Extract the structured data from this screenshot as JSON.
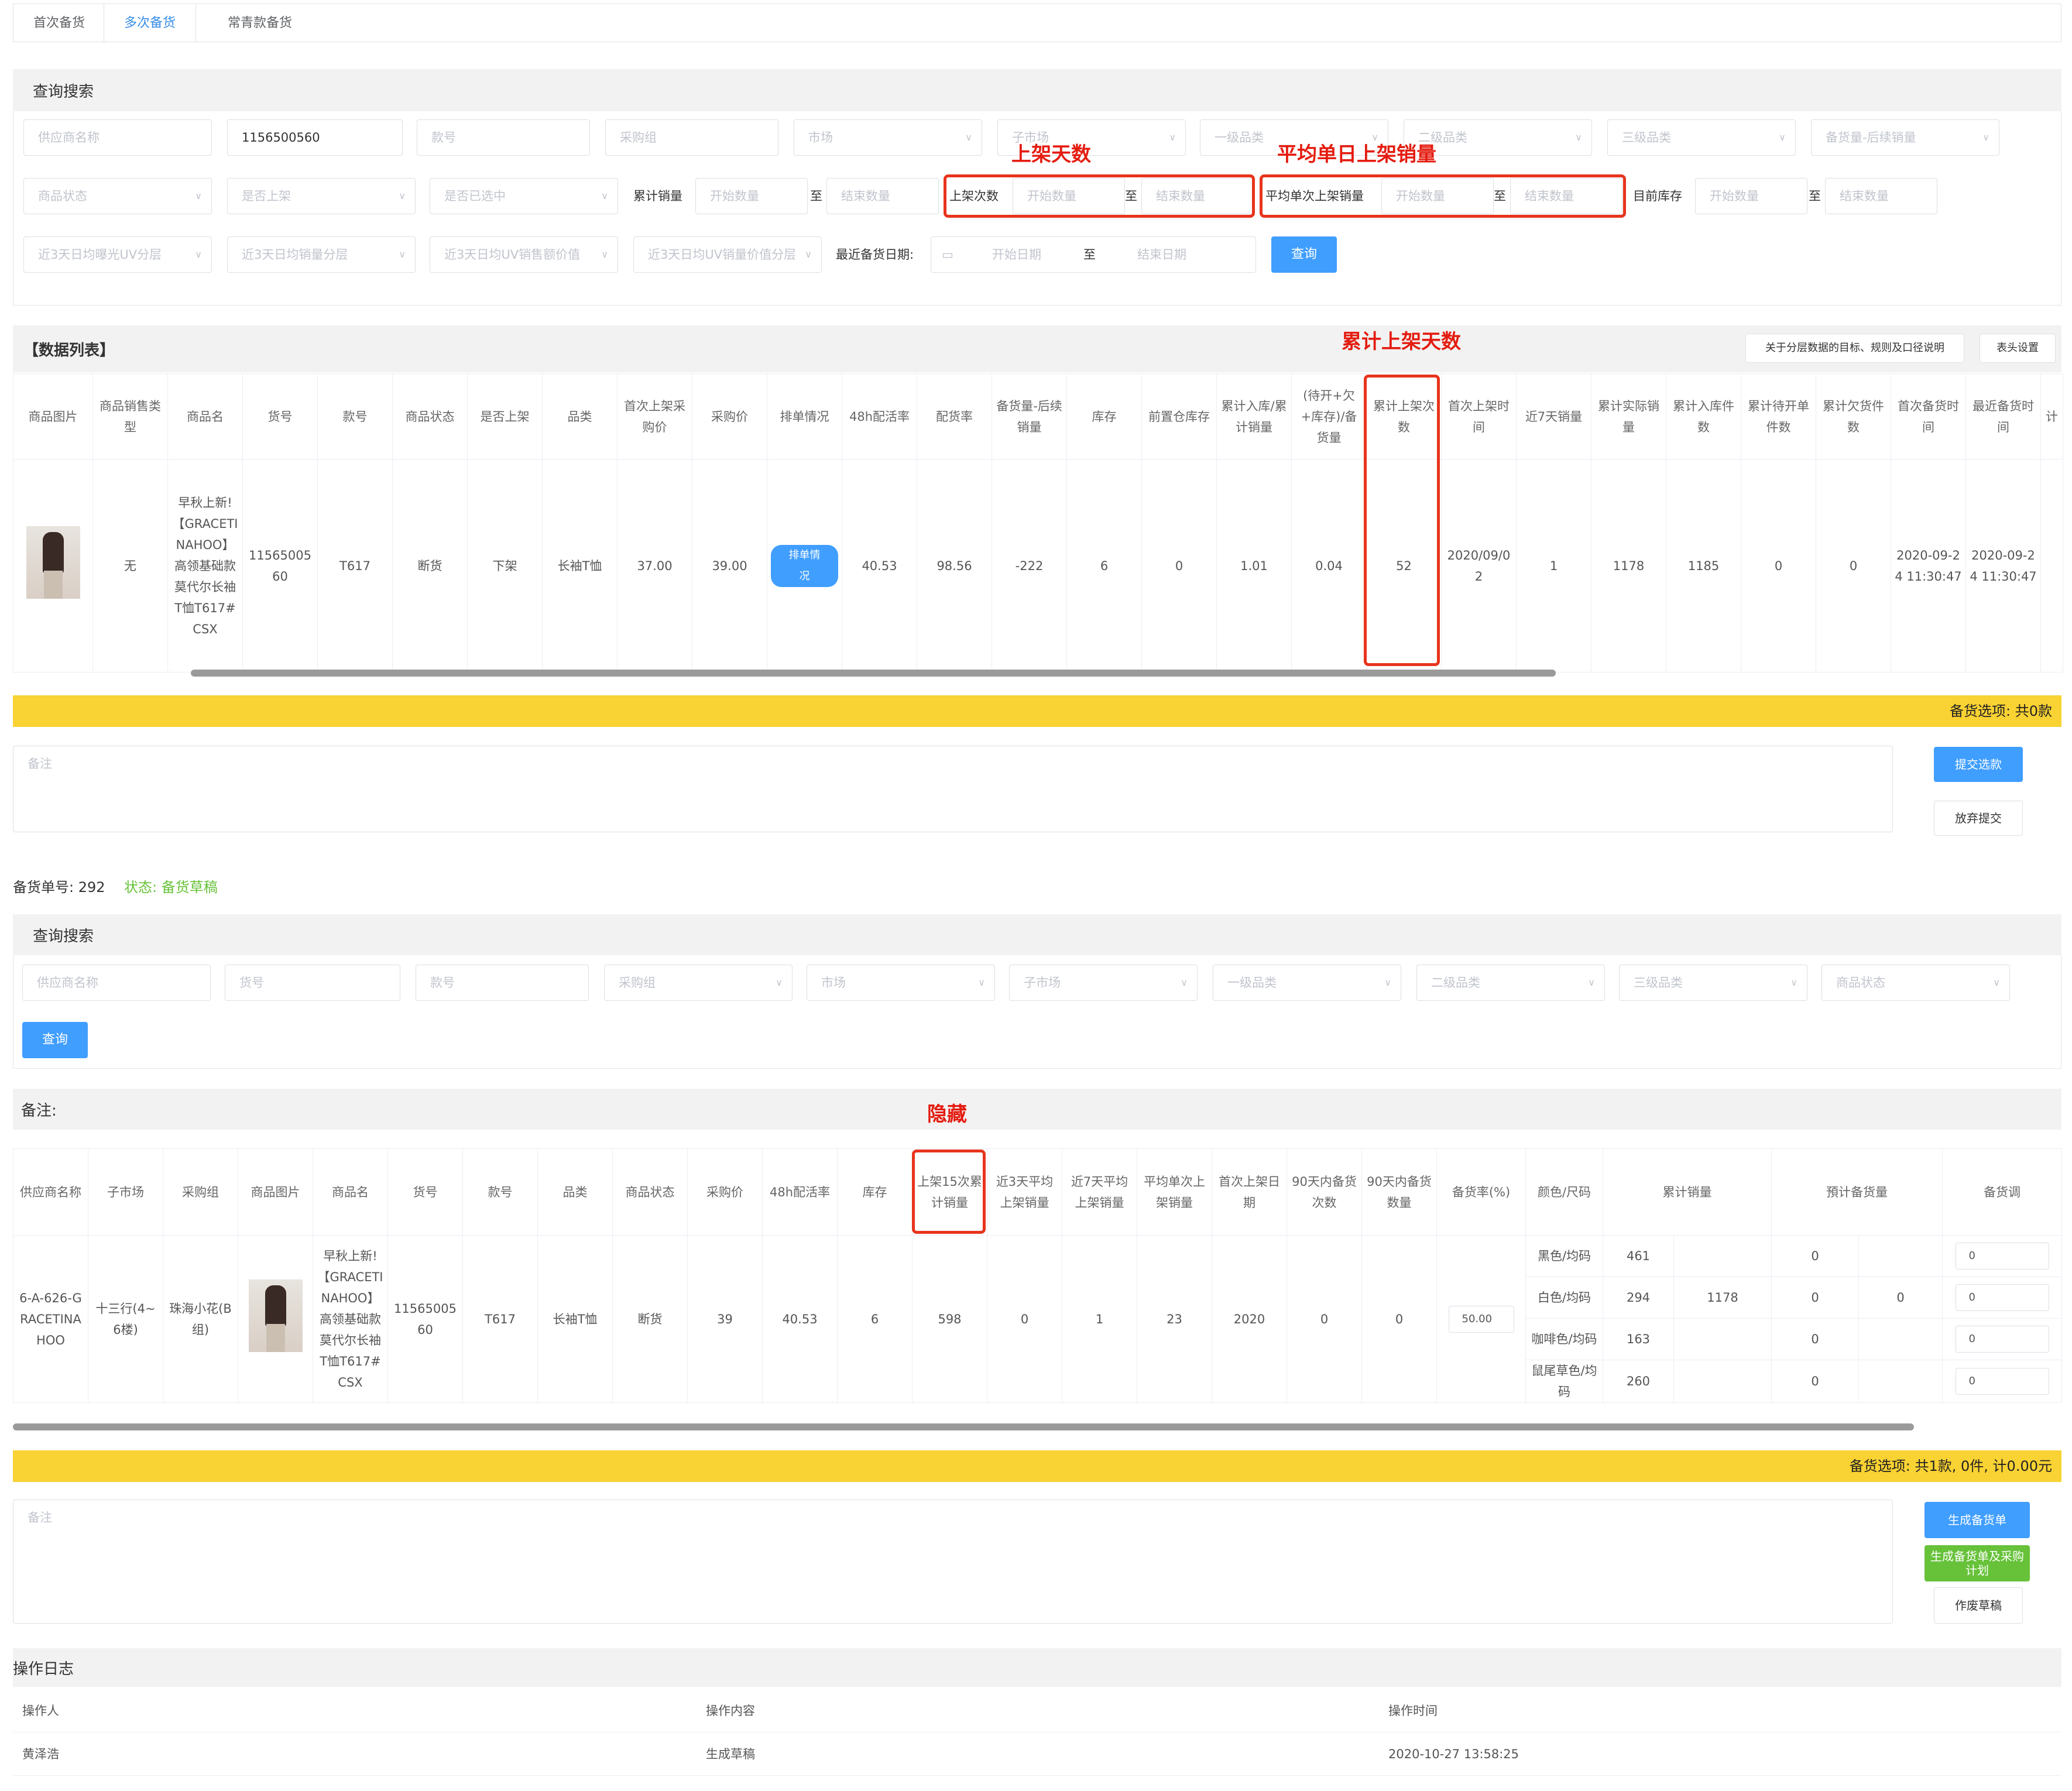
{
  "tabs": [
    "首次备货",
    "多次备货",
    "常青款备货"
  ],
  "search1": {
    "title": "查询搜索",
    "row1": [
      "供应商名称",
      "1156500560",
      "款号",
      "采购组",
      "市场",
      "子市场",
      "一级品类",
      "二级品类",
      "三级品类",
      "备货量-后续销量"
    ],
    "row2": {
      "status": "商品状态",
      "shelf": "是否上架",
      "selected": "是否已选中",
      "cum_sales_label": "累计销量",
      "start": "开始数量",
      "end": "结束数量",
      "zhi": "至",
      "shelf_times_label": "上架次数",
      "avg_label": "平均单次上架销量",
      "stock_label": "目前库存"
    },
    "row3": {
      "a": "近3天日均曝光UV分层",
      "b": "近3天日均销量分层",
      "c": "近3天日均UV销售额价值",
      "d": "近3天日均UV销量价值分层",
      "date_label": "最近备货日期:",
      "start_date": "开始日期",
      "end_date": "结束日期",
      "query": "查询"
    }
  },
  "annotations": {
    "shelf_days": "上架天数",
    "avg_daily": "平均单日上架销量",
    "cum_shelf_days": "累计上架天数",
    "hidden": "隐藏"
  },
  "list1": {
    "title": "【数据列表】",
    "btn_desc": "关于分层数据的目标、规则及口径说明",
    "btn_cols": "表头设置",
    "headers": [
      "商品图片",
      "商品销售类型",
      "商品名",
      "货号",
      "款号",
      "商品状态",
      "是否上架",
      "品类",
      "首次上架采购价",
      "采购价",
      "排单情况",
      "48h配活率",
      "配货率",
      "备货量-后续销量",
      "库存",
      "前置仓库存",
      "累计入库/累计销量",
      "(待开+欠+库存)/备货量",
      "累计上架次数",
      "首次上架时间",
      "近7天销量",
      "累计实际销量",
      "累计入库件数",
      "累计待开单件数",
      "累计欠货件数",
      "首次备货时间",
      "最近备货时间",
      "计"
    ],
    "row": [
      "",
      "无",
      "早秋上新!【GRACETINAHOO】高领基础款莫代尔长袖T恤T617# CSX",
      "1156500560",
      "T617",
      "断货",
      "下架",
      "长袖T恤",
      "37.00",
      "39.00",
      "排单情况",
      "40.53",
      "98.56",
      "-222",
      "6",
      "0",
      "1.01",
      "0.04",
      "52",
      "2020/09/02",
      "1",
      "1178",
      "1185",
      "0",
      "0",
      "2020-09-24 11:30:47",
      "2020-09-24 11:30:47",
      ""
    ]
  },
  "bar1": "备货选项: 共0款",
  "note_placeholder": "备注",
  "btn_submit": "提交选款",
  "btn_abandon": "放弃提交",
  "order": {
    "no_label": "备货单号: 292",
    "status": "状态: 备货草稿"
  },
  "search2": {
    "title": "查询搜索",
    "fields": [
      "供应商名称",
      "货号",
      "款号",
      "采购组",
      "市场",
      "子市场",
      "一级品类",
      "二级品类",
      "三级品类",
      "商品状态"
    ],
    "query": "查询"
  },
  "list2": {
    "title": "备注:",
    "headers": [
      "供应商名称",
      "子市场",
      "采购组",
      "商品图片",
      "商品名",
      "货号",
      "款号",
      "品类",
      "商品状态",
      "采购价",
      "48h配活率",
      "库存",
      "上架15次累计销量",
      "近3天平均上架销量",
      "近7天平均上架销量",
      "平均单次上架销量",
      "首次上架日期",
      "90天内备货次数",
      "90天内备货数量",
      "备货率(%)",
      "颜色/尺码",
      "累计销量",
      "預计备货量",
      "备货调"
    ],
    "row": [
      "6-A-626-GRACETINA HOO",
      "十三行(4~6楼)",
      "珠海小花(B组)",
      "",
      "早秋上新!【GRACETINAHOO】高领基础款莫代尔长袖T恤T617# CSX",
      "1156500560",
      "T617",
      "长袖T恤",
      "断货",
      "39",
      "40.53",
      "6",
      "598",
      "0",
      "1",
      "23",
      "2020",
      "0",
      "0",
      "50.00"
    ],
    "variants": [
      {
        "name": "黑色/均码",
        "sales": "461",
        "plan": "0",
        "input": "0"
      },
      {
        "name": "白色/均码",
        "sales": "294",
        "plan": "0",
        "input": "0"
      },
      {
        "name": "咖啡色/均码",
        "sales": "163",
        "plan": "0",
        "input": "0"
      },
      {
        "name": "鼠尾草色/均码",
        "sales": "260",
        "plan": "0",
        "input": "0"
      }
    ],
    "total_sales": "1178",
    "total_plan": "0"
  },
  "bar2": "备货选项: 共1款, 0件, 计0.00元",
  "btn_gen": "生成备货单",
  "btn_gen_plan": "生成备货单及采购计划",
  "btn_void": "作废草稿",
  "log": {
    "title": "操作日志",
    "headers": [
      "操作人",
      "操作内容",
      "操作时间"
    ],
    "row": [
      "黄泽浩",
      "生成草稿",
      "2020-10-27 13:58:25"
    ]
  },
  "colors": {
    "accent": "#409eff",
    "warn": "#f9d233",
    "annotation": "#e8341c",
    "status": "#67c23a"
  }
}
